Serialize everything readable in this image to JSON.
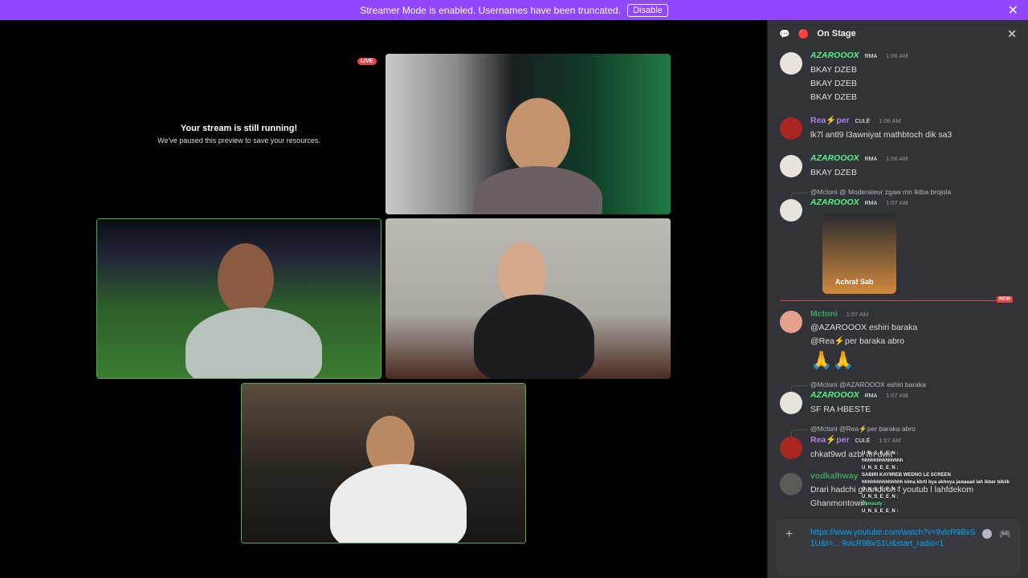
{
  "banner": {
    "text": "Streamer Mode is enabled. Usernames have been truncated.",
    "button": "Disable"
  },
  "stage": {
    "paused_title": "Your stream is still running!",
    "paused_sub": "We've paused this preview to save your resources.",
    "live_badge": "LIVE"
  },
  "sidebar": {
    "title": "On Stage",
    "messages": [
      {
        "name": "AZAROOOX",
        "badge": "RMA",
        "time": "1:06 AM",
        "lines": [
          "BKAY DZEB",
          "BKAY DZEB",
          "BKAY DZEB"
        ]
      },
      {
        "name": "Rea⚡per",
        "badge": "CULÉ",
        "time": "1:06 AM",
        "lines": [
          "lk7l antl9 l3awniyat mathbtoch dik sa3"
        ]
      },
      {
        "name": "AZAROOOX",
        "badge": "RMA",
        "time": "1:06 AM",
        "lines": [
          "BKAY DZEB"
        ]
      },
      {
        "reply": "@Mctoni @ Moderateur zgaw mn lktba brojola",
        "name": "AZAROOOX",
        "badge": "RMA",
        "time": "1:07 AM",
        "sticker": "Achraf Sab"
      },
      {
        "name": "Mctoni",
        "time": "1:07 AM",
        "lines": [
          "@AZAROOOX eshiri baraka",
          "@Rea⚡per baraka abro",
          "🙏🙏"
        ]
      },
      {
        "reply": "@Mctoni @AZAROOOX eshiri baraka",
        "name": "AZAROOOX",
        "badge": "RMA",
        "time": "1:07 AM",
        "lines": [
          "SF RA HBESTE"
        ]
      },
      {
        "reply": "@Mctoni @Rea⚡per baraka abro",
        "name": "Rea⚡per",
        "badge": "CULÉ",
        "time": "1:07 AM",
        "lines": [
          "chkat9wd azbi fin dwit"
        ]
      },
      {
        "name": "vodkalhway",
        "lines": [
          "Drari hadchi ghandiroh f youtub l lahfdekom",
          "Ghanmontowih"
        ]
      }
    ],
    "new_label": "NEW",
    "composer_text": "https://www.youtube.com/watch?v=9vlcR9BvS1U&t=... 9vlcR9BvS1U&start_radio=1"
  },
  "overlay": [
    {
      "n": "",
      "t": "U_N_S_E_E_N :"
    },
    {
      "n": "",
      "t": "hhhhhhhhhhhhhh"
    },
    {
      "n": "",
      "t": "U_N_S_E_E_N :"
    },
    {
      "n": "",
      "t": "SABIRI KAY9REB WEDNO LE SCREEN"
    },
    {
      "n": "",
      "t": "hhhhhhhhhhhhhh kima kbrti bya akhoya jawaaad lah ikber biklik"
    },
    {
      "n": "",
      "t": "U_N_S_E_E_N :"
    },
    {
      "n": "",
      "t": "U_N_S_E_E_N :"
    },
    {
      "n": "Benoudy :",
      "t": ""
    },
    {
      "n": "",
      "t": "U_N_S_E_E_N :"
    }
  ]
}
